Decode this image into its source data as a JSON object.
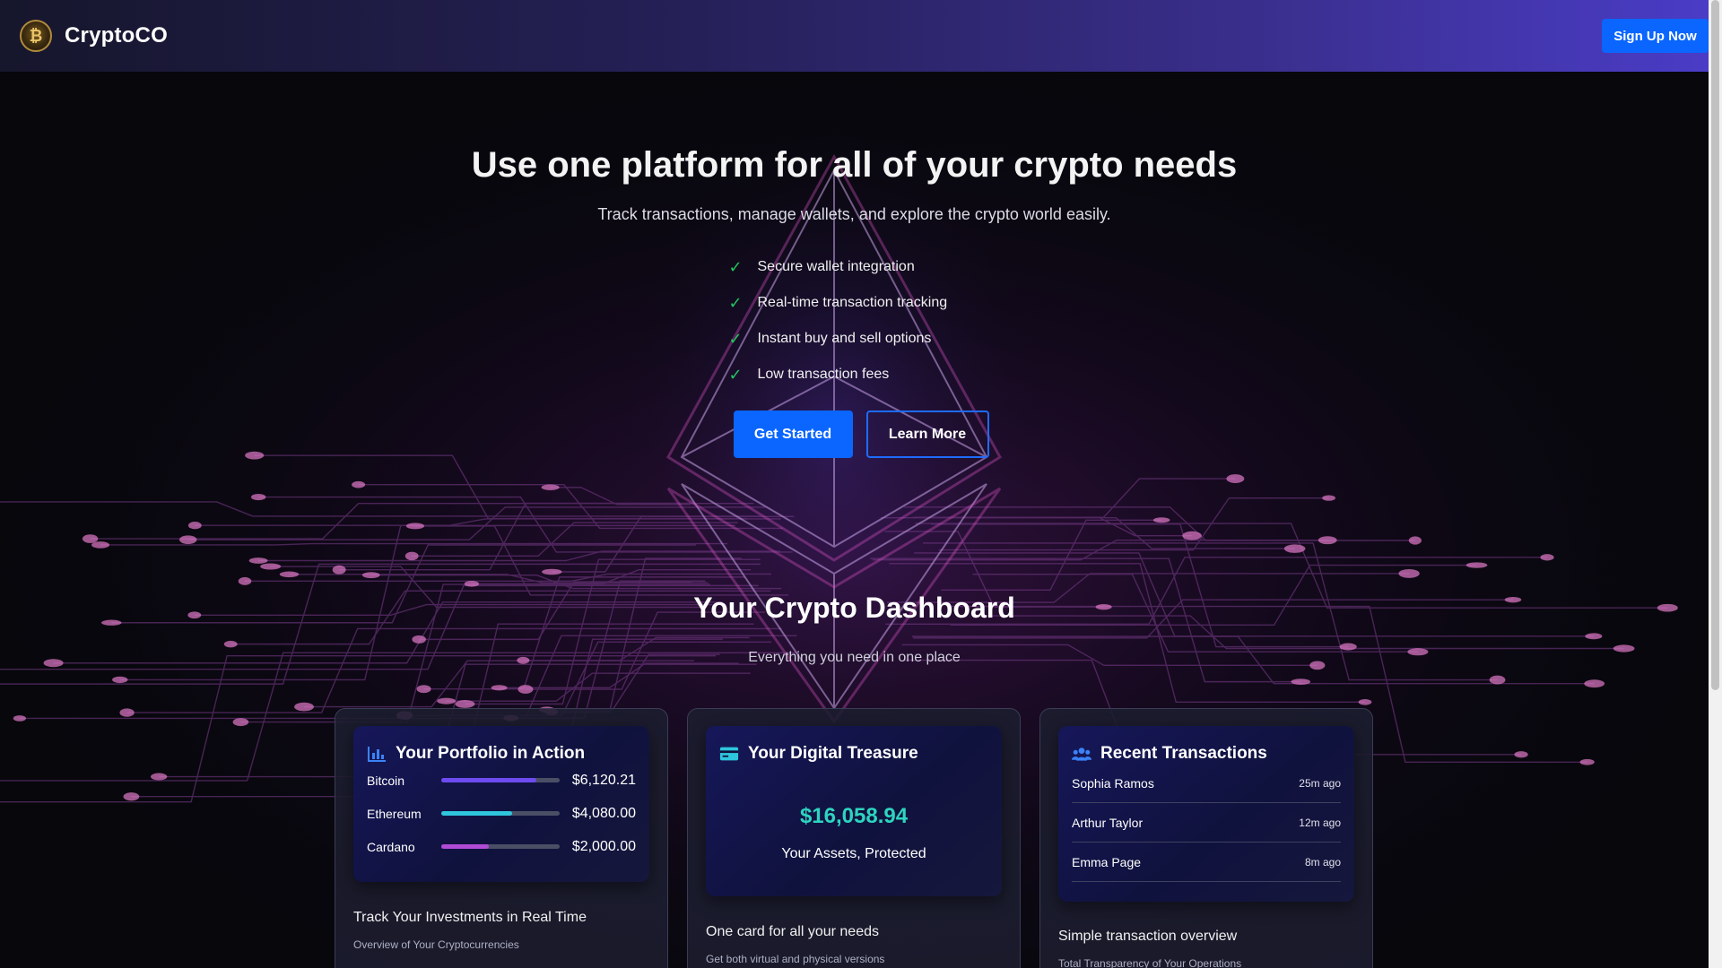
{
  "header": {
    "brand": "CryptoCO",
    "signup_label": "Sign Up Now"
  },
  "hero": {
    "title": "Use one platform for all of your crypto needs",
    "subtitle": "Track transactions, manage wallets, and explore the crypto world easily.",
    "features": [
      "Secure wallet integration",
      "Real-time transaction tracking",
      "Instant buy and sell options",
      "Low transaction fees"
    ],
    "primary_button": "Get Started",
    "secondary_button": "Learn More"
  },
  "dashboard": {
    "title": "Your Crypto Dashboard",
    "subtitle": "Everything you need in one place"
  },
  "portfolio": {
    "title": "Your Portfolio in Action",
    "rows": [
      {
        "coin": "Bitcoin",
        "amount": "$6,120.21",
        "fill": 0.8,
        "color": "#6d4bf0"
      },
      {
        "coin": "Ethereum",
        "amount": "$4,080.00",
        "fill": 0.6,
        "color": "#2ec5dd"
      },
      {
        "coin": "Cardano",
        "amount": "$2,000.00",
        "fill": 0.4,
        "color": "#b04bd6"
      }
    ],
    "caption": "Track Your Investments in Real Time",
    "note": "Overview of Your Cryptocurrencies"
  },
  "treasure": {
    "title": "Your Digital Treasure",
    "value": "$16,058.94",
    "subtitle": "Your Assets, Protected",
    "caption": "One card for all your needs",
    "note": "Get both virtual and physical versions"
  },
  "transactions": {
    "title": "Recent Transactions",
    "rows": [
      {
        "name": "Sophia Ramos",
        "time": "25m ago"
      },
      {
        "name": "Arthur Taylor",
        "time": "12m ago"
      },
      {
        "name": "Emma Page",
        "time": "8m ago"
      }
    ],
    "caption": "Simple transaction overview",
    "note": "Total Transparency of Your Operations"
  },
  "colors": {
    "accent": "#0a66ff",
    "check": "#22c55e",
    "treasure_value": "#2dd4bf",
    "icon": "#3b82f6"
  },
  "icons": {
    "logo": "bitcoin-coin-logo",
    "check": "check-icon",
    "portfolio": "bar-chart-icon",
    "treasure": "credit-card-icon",
    "transactions": "users-icon"
  }
}
